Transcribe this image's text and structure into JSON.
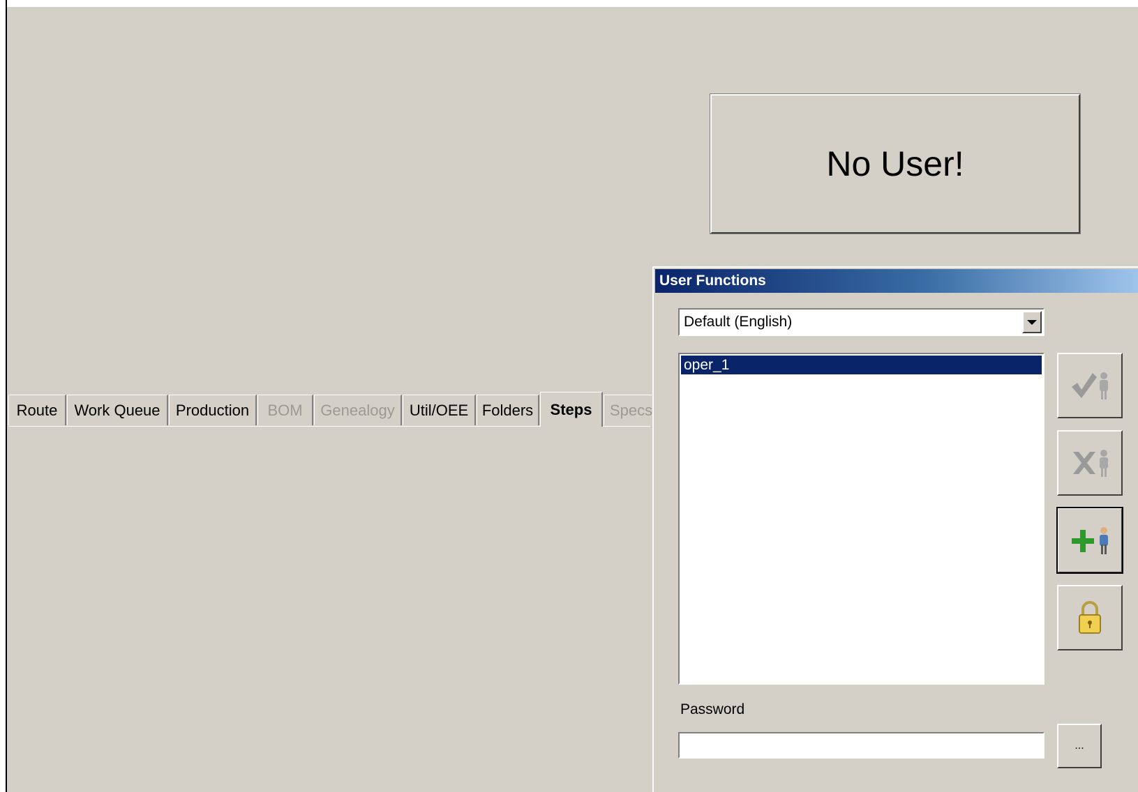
{
  "status_panel": {
    "text": "No User!"
  },
  "tabs": [
    {
      "label": "Route",
      "state": "normal"
    },
    {
      "label": "Work Queue",
      "state": "normal"
    },
    {
      "label": "Production",
      "state": "normal"
    },
    {
      "label": "BOM",
      "state": "disabled"
    },
    {
      "label": "Genealogy",
      "state": "disabled"
    },
    {
      "label": "Util/OEE",
      "state": "normal"
    },
    {
      "label": "Folders",
      "state": "normal"
    },
    {
      "label": "Steps",
      "state": "active"
    },
    {
      "label": "Specs",
      "state": "disabled"
    }
  ],
  "dialog": {
    "title": "User Functions",
    "language_select": {
      "value": "Default (English)"
    },
    "users": [
      {
        "name": "oper_1",
        "selected": true
      }
    ],
    "buttons": {
      "login": {
        "icon": "checkmark-user-icon"
      },
      "logout": {
        "icon": "x-user-icon"
      },
      "add_user": {
        "icon": "plus-user-icon"
      },
      "lock": {
        "icon": "padlock-icon"
      },
      "browse": {
        "label": "..."
      }
    },
    "password": {
      "label": "Password",
      "value": ""
    }
  },
  "colors": {
    "selection": "#0a246a",
    "window_bg": "#d4d0c8",
    "title_gradient_start": "#0a246a",
    "title_gradient_end": "#a6caf0"
  }
}
